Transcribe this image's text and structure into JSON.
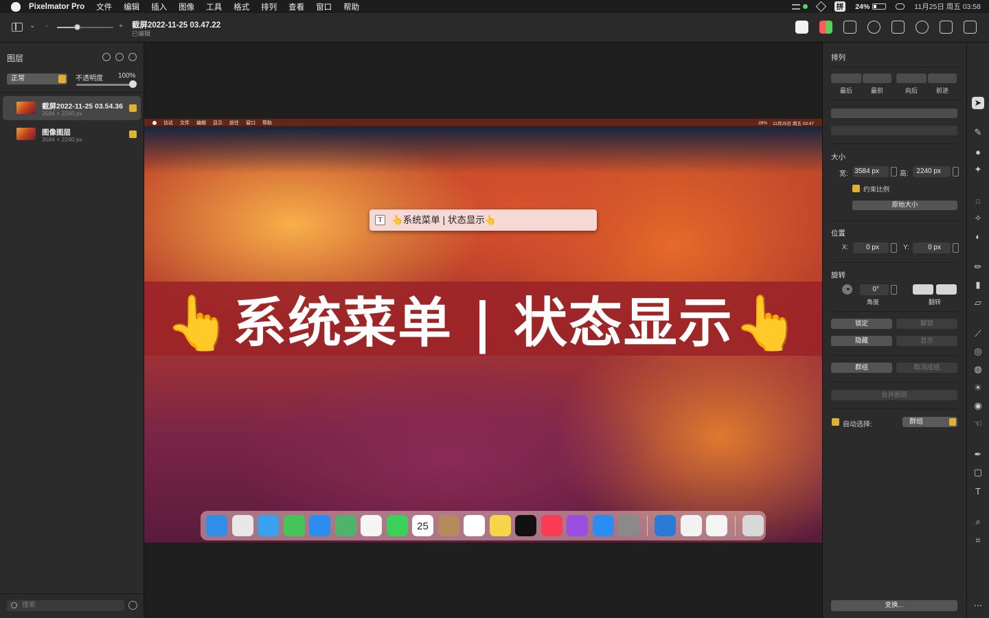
{
  "menubar": {
    "app_name": "Pixelmator Pro",
    "items": [
      "文件",
      "编辑",
      "插入",
      "图像",
      "工具",
      "格式",
      "排列",
      "查看",
      "窗口",
      "帮助"
    ],
    "input_method": "拼",
    "battery": "24%",
    "datetime": "11月25日 周五  03:58"
  },
  "toolbar": {
    "zoom_minus": "-",
    "zoom_plus": "+",
    "zoom_level": 0.35,
    "doc_title": "截屏2022-11-25 03.47.22",
    "doc_status": "已编辑",
    "icons": [
      "arrange-icon",
      "color-adjust-icon",
      "photo-browser-icon",
      "info-icon",
      "crop-share-icon",
      "more-icon",
      "share-icon",
      "sidebar-right-icon"
    ]
  },
  "layers_panel": {
    "title": "图层",
    "blend_mode": "正常",
    "opacity_label": "不透明度",
    "opacity_value": "100%",
    "layers": [
      {
        "name": "截屏2022-11-25 03.54.36",
        "size": "3584 × 2240 px",
        "visible": true,
        "selected": true
      },
      {
        "name": "图像图层",
        "size": "3584 × 2240 px",
        "visible": true,
        "selected": false
      }
    ],
    "search_placeholder": "搜索"
  },
  "canvas": {
    "inner_menu_items": [
      "访达",
      "文件",
      "编辑",
      "显示",
      "前往",
      "窗口",
      "帮助"
    ],
    "inner_battery": "28%",
    "inner_datetime": "11月25日 周五 03:47",
    "textbox_text": "👆系统菜单 | 状态显示👆",
    "textbox_icon": "T",
    "banner_text": "👆系统菜单 | 状态显示👆",
    "dock_date": "25",
    "dock_apps": [
      "finder",
      "launchpad",
      "safari",
      "messages",
      "mail",
      "maps",
      "photos",
      "facetime",
      "calendar",
      "contacts",
      "reminders",
      "notes",
      "tv",
      "music",
      "podcasts",
      "app-store",
      "system-settings",
      "bing",
      "chrome",
      "pixelmator",
      "trash"
    ],
    "dock_colors": [
      "#2f8fe8",
      "#e8e8e8",
      "#3aa0f0",
      "#45c45a",
      "#2d8cf0",
      "#4fb36a",
      "#f5f5f5",
      "#3ccf5a",
      "#ffffff",
      "#b48a5c",
      "#ffffff",
      "#f7d54a",
      "#111111",
      "#fa3c55",
      "#9b4de0",
      "#2b8df3",
      "#8a8a8a",
      "#2a7bd8",
      "#f2f2f2",
      "#f5f5f5",
      "#d8d8d8"
    ]
  },
  "arrange_panel": {
    "title": "排列",
    "order_buttons": [
      "最后",
      "最前",
      "向后",
      "前进"
    ],
    "size_title": "大小",
    "width_label": "宽:",
    "width_value": "3584 px",
    "height_label": "高:",
    "height_value": "2240 px",
    "constrain_label": "约束比例",
    "original_size_button": "原始大小",
    "position_title": "位置",
    "x_label": "X:",
    "x_value": "0 px",
    "y_label": "Y:",
    "y_value": "0 px",
    "rotate_title": "旋转",
    "angle_value": "0°",
    "angle_label": "角度",
    "flip_label": "翻转",
    "lock_button": "锁定",
    "unlock_button": "解锁",
    "hide_button": "隐藏",
    "show_button": "显示",
    "group_button": "群组",
    "ungroup_button": "取消成组",
    "merge_button": "合并图层",
    "auto_select_label": "自动选择:",
    "auto_select_value": "群组",
    "transform_button": "变换..."
  },
  "colors": {
    "accent": "#e0b22e",
    "panel_bg": "#2b2b2b",
    "canvas_bg": "#1f1f1f",
    "banner_bg": "#9b2328"
  }
}
